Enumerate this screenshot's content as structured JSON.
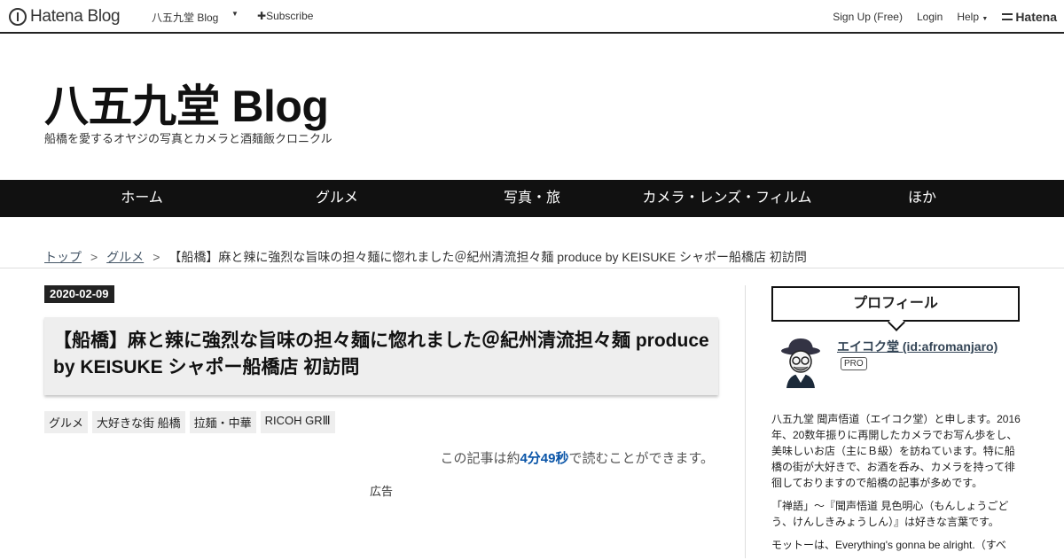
{
  "topbar": {
    "brand": "Hatena Blog",
    "blog_name": "八五九堂 Blog",
    "subscribe": "Subscribe",
    "signup": "Sign Up (Free)",
    "login": "Login",
    "help": "Help",
    "hatena": "Hatena"
  },
  "header": {
    "title": "八五九堂 Blog",
    "description": "船橋を愛するオヤジの写真とカメラと酒麺飯クロニクル"
  },
  "nav": [
    "ホーム",
    "グルメ",
    "写真・旅",
    "カメラ・レンズ・フィルム",
    "ほか"
  ],
  "breadcrumb": {
    "top": "トップ",
    "sep": ">",
    "category": "グルメ",
    "current": "【船橋】麻と辣に強烈な旨味の担々麺に惚れました＠紀州清流担々麺 produce by KEISUKE シャポー船橋店 初訪問"
  },
  "article": {
    "date": "2020-02-09",
    "title": "【船橋】麻と辣に強烈な旨味の担々麺に惚れました＠紀州清流担々麺 produce by KEISUKE シャポー船橋店 初訪問",
    "categories": [
      "グルメ",
      "大好きな街 船橋",
      "拉麺・中華",
      "RICOH GRⅢ"
    ],
    "read_prefix": "この記事は約",
    "read_time": "4分49秒",
    "read_suffix": "で読むことができます。",
    "ad_label": "広告"
  },
  "sidebar": {
    "profile_heading": "プロフィール",
    "user_name": "エイコク堂 (id:afromanjaro)",
    "badge": "PRO",
    "bio": [
      "八五九堂 聞声悟道（エイコク堂）と申します。2016年、20数年振りに再開したカメラでお写ん歩をし、美味しいお店（主にＢ級）を訪ねています。特に船橋の街が大好きで、お酒を呑み、カメラを持って徘徊しておりますので船橋の記事が多めです。",
      "「禅語」～『聞声悟道 見色明心（もんしょうごどう、けんしきみょうしん）』は好きな言葉です。",
      "モットーは、Everything's gonna be alright.（すべ"
    ]
  }
}
